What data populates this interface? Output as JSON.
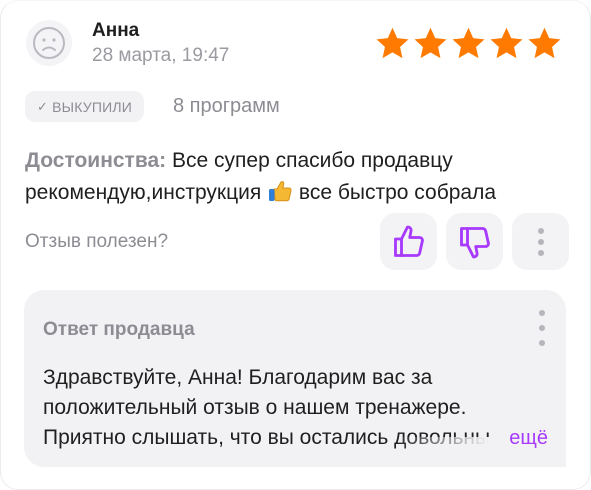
{
  "review": {
    "author": "Анна",
    "date": "28 марта, 19:47",
    "rating": 5,
    "badge": "ВЫКУПИЛИ",
    "badge_check": "✓",
    "variant": "8 программ",
    "text_label": "Достоинства:",
    "text_part1": "Все супер спасибо продавцу рекомендую,инструкция",
    "text_part2": "все быстро собрала",
    "helpful_question": "Отзыв полезен?"
  },
  "reply": {
    "title": "Ответ продавца",
    "body": "Здравствуйте, Анна! Благодарим вас за положительный отзыв о нашем тренажере. Приятно слышать, что вы остались довольны",
    "more_link": "ещё"
  },
  "icons": {
    "avatar": "user-avatar-icon",
    "star": "star-icon",
    "like": "thumbs-up-icon",
    "dislike": "thumbs-down-icon",
    "more": "more-vertical-icon"
  },
  "colors": {
    "star": "#ff7a00",
    "accent": "#a73afd",
    "muted": "#8c8c93",
    "card_bg": "#f2f2f4"
  }
}
